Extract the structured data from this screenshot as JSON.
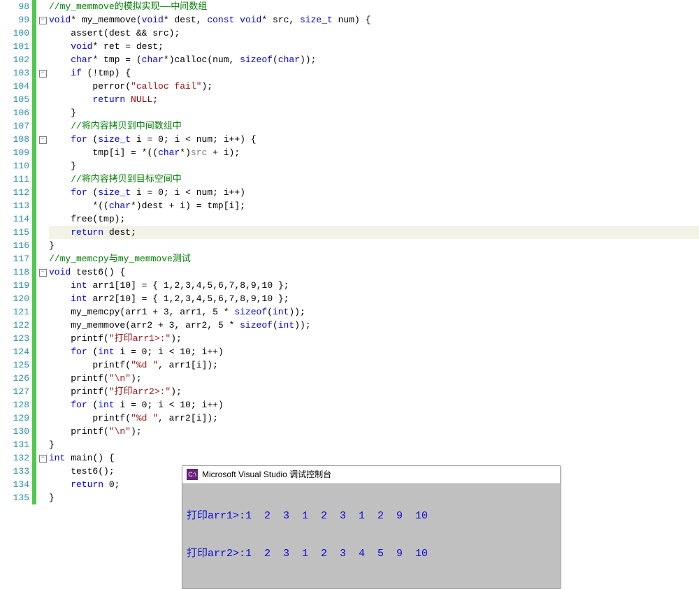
{
  "line_start": 98,
  "line_end": 135,
  "highlight_line": 115,
  "fold_boxes": [
    99,
    103,
    108,
    118,
    132
  ],
  "code_tokens": {
    "98": [
      [
        "cm",
        "//my_memmove的模拟实现——中间数组"
      ]
    ],
    "99": [
      [
        "kw",
        "void"
      ],
      [
        "op",
        "* "
      ],
      [
        "id",
        "my_memmove"
      ],
      [
        "paren",
        "("
      ],
      [
        "kw",
        "void"
      ],
      [
        "op",
        "* "
      ],
      [
        "id",
        "dest"
      ],
      [
        "op",
        ", "
      ],
      [
        "kw",
        "const"
      ],
      [
        "op",
        " "
      ],
      [
        "kw",
        "void"
      ],
      [
        "op",
        "* "
      ],
      [
        "id",
        "src"
      ],
      [
        "op",
        ", "
      ],
      [
        "sizet",
        "size_t"
      ],
      [
        "op",
        " "
      ],
      [
        "id",
        "num"
      ],
      [
        "paren",
        ") {"
      ]
    ],
    "100": [
      [
        "id",
        "    assert"
      ],
      [
        "paren",
        "("
      ],
      [
        "id",
        "dest "
      ],
      [
        "op",
        "&&"
      ],
      [
        "id",
        " src"
      ],
      [
        "paren",
        ")"
      ],
      [
        "op",
        ";"
      ]
    ],
    "101": [
      [
        "op",
        "    "
      ],
      [
        "kw",
        "void"
      ],
      [
        "op",
        "* "
      ],
      [
        "id",
        "ret "
      ],
      [
        "op",
        "= "
      ],
      [
        "id",
        "dest"
      ],
      [
        "op",
        ";"
      ]
    ],
    "102": [
      [
        "op",
        "    "
      ],
      [
        "kw",
        "char"
      ],
      [
        "op",
        "* "
      ],
      [
        "id",
        "tmp "
      ],
      [
        "op",
        "= ("
      ],
      [
        "kw",
        "char"
      ],
      [
        "op",
        "*)"
      ],
      [
        "id",
        "calloc"
      ],
      [
        "paren",
        "("
      ],
      [
        "id",
        "num"
      ],
      [
        "op",
        ", "
      ],
      [
        "kw",
        "sizeof"
      ],
      [
        "paren",
        "("
      ],
      [
        "kw",
        "char"
      ],
      [
        "paren",
        "))"
      ],
      [
        "op",
        ";"
      ]
    ],
    "103": [
      [
        "op",
        "    "
      ],
      [
        "kw",
        "if"
      ],
      [
        "op",
        " ("
      ],
      [
        "op",
        "!"
      ],
      [
        "id",
        "tmp"
      ],
      [
        "paren",
        ") {"
      ]
    ],
    "104": [
      [
        "id",
        "        perror"
      ],
      [
        "paren",
        "("
      ],
      [
        "str",
        "\"calloc fail\""
      ],
      [
        "paren",
        ")"
      ],
      [
        "op",
        ";"
      ]
    ],
    "105": [
      [
        "op",
        "        "
      ],
      [
        "kw",
        "return"
      ],
      [
        "op",
        " "
      ],
      [
        "darkred",
        "NULL"
      ],
      [
        "op",
        ";"
      ]
    ],
    "106": [
      [
        "paren",
        "    }"
      ]
    ],
    "107": [
      [
        "cm",
        "    //将内容拷贝到中间数组中"
      ]
    ],
    "108": [
      [
        "op",
        "    "
      ],
      [
        "kw",
        "for"
      ],
      [
        "op",
        " ("
      ],
      [
        "sizet",
        "size_t"
      ],
      [
        "op",
        " "
      ],
      [
        "id",
        "i "
      ],
      [
        "op",
        "= "
      ],
      [
        "num",
        "0"
      ],
      [
        "op",
        "; "
      ],
      [
        "id",
        "i "
      ],
      [
        "op",
        "< "
      ],
      [
        "id",
        "num"
      ],
      [
        "op",
        "; "
      ],
      [
        "id",
        "i"
      ],
      [
        "op",
        "++) {"
      ]
    ],
    "109": [
      [
        "id",
        "        tmp"
      ],
      [
        "op",
        "["
      ],
      [
        "id",
        "i"
      ],
      [
        "op",
        "] = *(("
      ],
      [
        "kw",
        "char"
      ],
      [
        "op",
        "*)"
      ],
      [
        "gray",
        "src"
      ],
      [
        "op",
        " + "
      ],
      [
        "id",
        "i"
      ],
      [
        "op",
        ");"
      ]
    ],
    "110": [
      [
        "paren",
        "    }"
      ]
    ],
    "111": [
      [
        "cm",
        "    //将内容拷贝到目标空间中"
      ]
    ],
    "112": [
      [
        "op",
        "    "
      ],
      [
        "kw",
        "for"
      ],
      [
        "op",
        " ("
      ],
      [
        "sizet",
        "size_t"
      ],
      [
        "op",
        " "
      ],
      [
        "id",
        "i "
      ],
      [
        "op",
        "= "
      ],
      [
        "num",
        "0"
      ],
      [
        "op",
        "; "
      ],
      [
        "id",
        "i "
      ],
      [
        "op",
        "< "
      ],
      [
        "id",
        "num"
      ],
      [
        "op",
        "; "
      ],
      [
        "id",
        "i"
      ],
      [
        "op",
        "++)"
      ]
    ],
    "113": [
      [
        "op",
        "        *(("
      ],
      [
        "kw",
        "char"
      ],
      [
        "op",
        "*)"
      ],
      [
        "id",
        "dest "
      ],
      [
        "op",
        "+ "
      ],
      [
        "id",
        "i"
      ],
      [
        "op",
        ") = "
      ],
      [
        "id",
        "tmp"
      ],
      [
        "op",
        "["
      ],
      [
        "id",
        "i"
      ],
      [
        "op",
        "];"
      ]
    ],
    "114": [
      [
        "id",
        "    free"
      ],
      [
        "paren",
        "("
      ],
      [
        "id",
        "tmp"
      ],
      [
        "paren",
        ")"
      ],
      [
        "op",
        ";"
      ]
    ],
    "115": [
      [
        "op",
        "    "
      ],
      [
        "kw",
        "return"
      ],
      [
        "op",
        " "
      ],
      [
        "id",
        "dest"
      ],
      [
        "op",
        ";"
      ]
    ],
    "116": [
      [
        "paren",
        "}"
      ]
    ],
    "117": [
      [
        "cm",
        "//my_memcpy与my_memmove测试"
      ]
    ],
    "118": [
      [
        "kw",
        "void"
      ],
      [
        "op",
        " "
      ],
      [
        "id",
        "test6"
      ],
      [
        "paren",
        "() {"
      ]
    ],
    "119": [
      [
        "op",
        "    "
      ],
      [
        "kw",
        "int"
      ],
      [
        "op",
        " "
      ],
      [
        "id",
        "arr1"
      ],
      [
        "op",
        "["
      ],
      [
        "num",
        "10"
      ],
      [
        "op",
        "] = { "
      ],
      [
        "num",
        "1"
      ],
      [
        "op",
        ","
      ],
      [
        "num",
        "2"
      ],
      [
        "op",
        ","
      ],
      [
        "num",
        "3"
      ],
      [
        "op",
        ","
      ],
      [
        "num",
        "4"
      ],
      [
        "op",
        ","
      ],
      [
        "num",
        "5"
      ],
      [
        "op",
        ","
      ],
      [
        "num",
        "6"
      ],
      [
        "op",
        ","
      ],
      [
        "num",
        "7"
      ],
      [
        "op",
        ","
      ],
      [
        "num",
        "8"
      ],
      [
        "op",
        ","
      ],
      [
        "num",
        "9"
      ],
      [
        "op",
        ","
      ],
      [
        "num",
        "10"
      ],
      [
        "op",
        " };"
      ]
    ],
    "120": [
      [
        "op",
        "    "
      ],
      [
        "kw",
        "int"
      ],
      [
        "op",
        " "
      ],
      [
        "id",
        "arr2"
      ],
      [
        "op",
        "["
      ],
      [
        "num",
        "10"
      ],
      [
        "op",
        "] = { "
      ],
      [
        "num",
        "1"
      ],
      [
        "op",
        ","
      ],
      [
        "num",
        "2"
      ],
      [
        "op",
        ","
      ],
      [
        "num",
        "3"
      ],
      [
        "op",
        ","
      ],
      [
        "num",
        "4"
      ],
      [
        "op",
        ","
      ],
      [
        "num",
        "5"
      ],
      [
        "op",
        ","
      ],
      [
        "num",
        "6"
      ],
      [
        "op",
        ","
      ],
      [
        "num",
        "7"
      ],
      [
        "op",
        ","
      ],
      [
        "num",
        "8"
      ],
      [
        "op",
        ","
      ],
      [
        "num",
        "9"
      ],
      [
        "op",
        ","
      ],
      [
        "num",
        "10"
      ],
      [
        "op",
        " };"
      ]
    ],
    "121": [
      [
        "id",
        "    my_memcpy"
      ],
      [
        "paren",
        "("
      ],
      [
        "id",
        "arr1 "
      ],
      [
        "op",
        "+ "
      ],
      [
        "num",
        "3"
      ],
      [
        "op",
        ", "
      ],
      [
        "id",
        "arr1"
      ],
      [
        "op",
        ", "
      ],
      [
        "num",
        "5"
      ],
      [
        "op",
        " * "
      ],
      [
        "kw",
        "sizeof"
      ],
      [
        "paren",
        "("
      ],
      [
        "kw",
        "int"
      ],
      [
        "paren",
        "))"
      ],
      [
        "op",
        ";"
      ]
    ],
    "122": [
      [
        "id",
        "    my_memmove"
      ],
      [
        "paren",
        "("
      ],
      [
        "id",
        "arr2 "
      ],
      [
        "op",
        "+ "
      ],
      [
        "num",
        "3"
      ],
      [
        "op",
        ", "
      ],
      [
        "id",
        "arr2"
      ],
      [
        "op",
        ", "
      ],
      [
        "num",
        "5"
      ],
      [
        "op",
        " * "
      ],
      [
        "kw",
        "sizeof"
      ],
      [
        "paren",
        "("
      ],
      [
        "kw",
        "int"
      ],
      [
        "paren",
        "))"
      ],
      [
        "op",
        ";"
      ]
    ],
    "123": [
      [
        "id",
        "    printf"
      ],
      [
        "paren",
        "("
      ],
      [
        "str",
        "\"打印arr1>:\""
      ],
      [
        "paren",
        ")"
      ],
      [
        "op",
        ";"
      ]
    ],
    "124": [
      [
        "op",
        "    "
      ],
      [
        "kw",
        "for"
      ],
      [
        "op",
        " ("
      ],
      [
        "kw",
        "int"
      ],
      [
        "op",
        " "
      ],
      [
        "id",
        "i "
      ],
      [
        "op",
        "= "
      ],
      [
        "num",
        "0"
      ],
      [
        "op",
        "; "
      ],
      [
        "id",
        "i "
      ],
      [
        "op",
        "< "
      ],
      [
        "num",
        "10"
      ],
      [
        "op",
        "; "
      ],
      [
        "id",
        "i"
      ],
      [
        "op",
        "++)"
      ]
    ],
    "125": [
      [
        "id",
        "        printf"
      ],
      [
        "paren",
        "("
      ],
      [
        "str",
        "\"%d \""
      ],
      [
        "op",
        ", "
      ],
      [
        "id",
        "arr1"
      ],
      [
        "op",
        "["
      ],
      [
        "id",
        "i"
      ],
      [
        "op",
        "]);"
      ]
    ],
    "126": [
      [
        "id",
        "    printf"
      ],
      [
        "paren",
        "("
      ],
      [
        "str",
        "\"\\n\""
      ],
      [
        "paren",
        ")"
      ],
      [
        "op",
        ";"
      ]
    ],
    "127": [
      [
        "id",
        "    printf"
      ],
      [
        "paren",
        "("
      ],
      [
        "str",
        "\"打印arr2>:\""
      ],
      [
        "paren",
        ")"
      ],
      [
        "op",
        ";"
      ]
    ],
    "128": [
      [
        "op",
        "    "
      ],
      [
        "kw",
        "for"
      ],
      [
        "op",
        " ("
      ],
      [
        "kw",
        "int"
      ],
      [
        "op",
        " "
      ],
      [
        "id",
        "i "
      ],
      [
        "op",
        "= "
      ],
      [
        "num",
        "0"
      ],
      [
        "op",
        "; "
      ],
      [
        "id",
        "i "
      ],
      [
        "op",
        "< "
      ],
      [
        "num",
        "10"
      ],
      [
        "op",
        "; "
      ],
      [
        "id",
        "i"
      ],
      [
        "op",
        "++)"
      ]
    ],
    "129": [
      [
        "id",
        "        printf"
      ],
      [
        "paren",
        "("
      ],
      [
        "str",
        "\"%d \""
      ],
      [
        "op",
        ", "
      ],
      [
        "id",
        "arr2"
      ],
      [
        "op",
        "["
      ],
      [
        "id",
        "i"
      ],
      [
        "op",
        "]);"
      ]
    ],
    "130": [
      [
        "id",
        "    printf"
      ],
      [
        "paren",
        "("
      ],
      [
        "str",
        "\"\\n\""
      ],
      [
        "paren",
        ")"
      ],
      [
        "op",
        ";"
      ]
    ],
    "131": [
      [
        "paren",
        "}"
      ]
    ],
    "132": [
      [
        "kw",
        "int"
      ],
      [
        "op",
        " "
      ],
      [
        "id",
        "main"
      ],
      [
        "paren",
        "() {"
      ]
    ],
    "133": [
      [
        "id",
        "    test6"
      ],
      [
        "paren",
        "()"
      ],
      [
        "op",
        ";"
      ]
    ],
    "134": [
      [
        "op",
        "    "
      ],
      [
        "kw",
        "return"
      ],
      [
        "op",
        " "
      ],
      [
        "num",
        "0"
      ],
      [
        "op",
        ";"
      ]
    ],
    "135": [
      [
        "paren",
        "}"
      ]
    ]
  },
  "code_indent": {
    "98": 1,
    "99": 1,
    "100": 2,
    "101": 2,
    "102": 2,
    "103": 2,
    "104": 3,
    "105": 3,
    "106": 2,
    "107": 2,
    "108": 2,
    "109": 3,
    "110": 2,
    "111": 2,
    "112": 2,
    "113": 3,
    "114": 2,
    "115": 2,
    "116": 1,
    "117": 1,
    "118": 1,
    "119": 2,
    "120": 2,
    "121": 2,
    "122": 2,
    "123": 2,
    "124": 2,
    "125": 3,
    "126": 2,
    "127": 2,
    "128": 2,
    "129": 3,
    "130": 2,
    "131": 1,
    "132": 0,
    "133": 2,
    "134": 2,
    "135": 1
  },
  "console": {
    "title": "Microsoft Visual Studio 调试控制台",
    "icon_text": "C:\\",
    "lines": [
      "打印arr1>:1  2  3  1  2  3  1  2  9  10",
      "打印arr2>:1  2  3  1  2  3  4  5  9  10"
    ]
  }
}
